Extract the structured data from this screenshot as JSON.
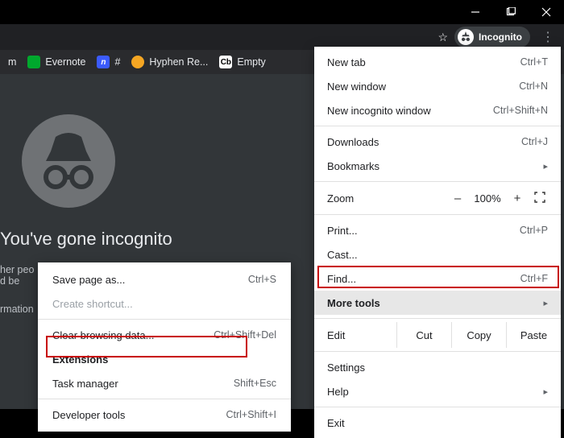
{
  "window": {
    "incognito_pill": "Incognito"
  },
  "bookmarks": [
    {
      "icon": "",
      "label": "m"
    },
    {
      "icon": "",
      "label": "Evernote"
    },
    {
      "icon": "n",
      "label": "#"
    },
    {
      "icon": "",
      "label": "Hyphen Re..."
    },
    {
      "icon": "Cb",
      "label": "Empty"
    }
  ],
  "page": {
    "title": "You've gone incognito",
    "p1a": "her peo",
    "p1b": "d be",
    "p2": "rmation"
  },
  "menu": {
    "new_tab": "New tab",
    "new_tab_sc": "Ctrl+T",
    "new_window": "New window",
    "new_window_sc": "Ctrl+N",
    "new_incog": "New incognito window",
    "new_incog_sc": "Ctrl+Shift+N",
    "downloads": "Downloads",
    "downloads_sc": "Ctrl+J",
    "bookmarks": "Bookmarks",
    "zoom": "Zoom",
    "zoom_minus": "–",
    "zoom_val": "100%",
    "zoom_plus": "+",
    "print": "Print...",
    "print_sc": "Ctrl+P",
    "cast": "Cast...",
    "find": "Find...",
    "find_sc": "Ctrl+F",
    "more_tools": "More tools",
    "edit": "Edit",
    "cut": "Cut",
    "copy": "Copy",
    "paste": "Paste",
    "settings": "Settings",
    "help": "Help",
    "exit": "Exit"
  },
  "submenu": {
    "save_page": "Save page as...",
    "save_page_sc": "Ctrl+S",
    "create_shortcut": "Create shortcut...",
    "clear_data": "Clear browsing data...",
    "clear_data_sc": "Ctrl+Shift+Del",
    "extensions": "Extensions",
    "task_manager": "Task manager",
    "task_manager_sc": "Shift+Esc",
    "dev_tools": "Developer tools",
    "dev_tools_sc": "Ctrl+Shift+I"
  }
}
